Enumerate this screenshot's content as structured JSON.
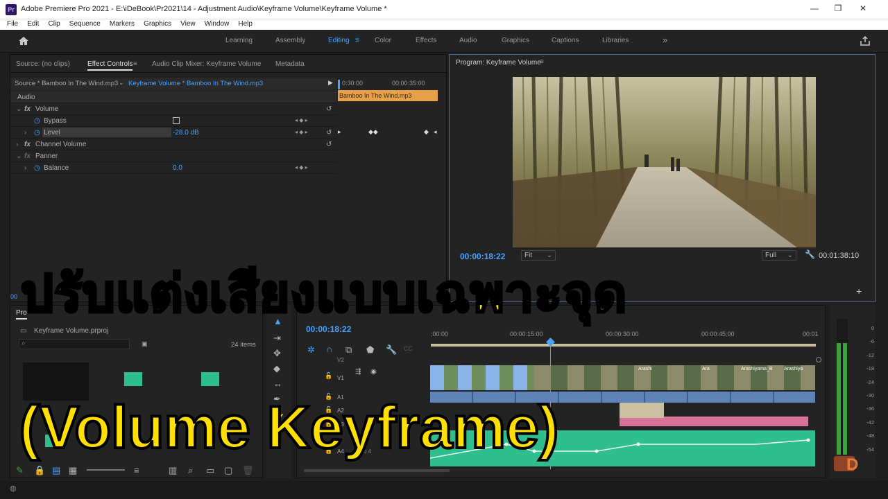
{
  "window": {
    "title": "Adobe Premiere Pro 2021 - E:\\iDeBook\\Pr2021\\14 - Adjustment Audio\\Keyframe Volume\\Keyframe Volume *",
    "app_icon": "Pr"
  },
  "menu": [
    "File",
    "Edit",
    "Clip",
    "Sequence",
    "Markers",
    "Graphics",
    "View",
    "Window",
    "Help"
  ],
  "workspaces": [
    "Learning",
    "Assembly",
    "Editing",
    "Color",
    "Effects",
    "Audio",
    "Graphics",
    "Captions",
    "Libraries"
  ],
  "active_workspace": "Editing",
  "source_panel": {
    "tabs": [
      "Source: (no clips)",
      "Effect Controls",
      "Audio Clip Mixer: Keyframe Volume",
      "Metadata"
    ],
    "active_tab": "Effect Controls",
    "master_clip": "Source * Bamboo In The Wind.mp3",
    "sequence_clip": "Keyframe Volume * Bamboo In The Wind.mp3",
    "ruler_start": "0:30:00",
    "ruler_end": "00:00:35:00",
    "clip_bar_label": "Bamboo In The Wind.mp3",
    "section": "Audio",
    "effects": {
      "volume": "Volume",
      "bypass": "Bypass",
      "level": "Level",
      "level_value": "-28.0 dB",
      "channel_volume": "Channel Volume",
      "panner": "Panner",
      "balance": "Balance",
      "balance_value": "0.0"
    },
    "fx_label": "fx"
  },
  "program_monitor": {
    "title": "Program: Keyframe Volume",
    "timecode": "00:00:18:22",
    "fit": "Fit",
    "quality": "Full",
    "duration": "00:01:38:10"
  },
  "project_panel": {
    "tab": "Pro",
    "project_file": "Keyframe Volume.prproj",
    "items_count": "24 items"
  },
  "timeline": {
    "timecode": "00:00:18:22",
    "ruler": [
      ":00:00",
      "00:00:15:00",
      "00:00:30:00",
      "00:00:45:00",
      "00:01"
    ],
    "tracks": [
      "V2",
      "V1",
      "A1",
      "A2",
      "A3",
      "A4"
    ],
    "v1_clip_labels": [
      "Arashi",
      "Ara",
      "Arashiyama_B",
      "Arashiya"
    ],
    "a4_label": "Audio 4"
  },
  "audio_meter": {
    "scale": [
      "0",
      "-6",
      "-12",
      "-18",
      "-24",
      "-30",
      "-36",
      "-42",
      "-48",
      "-54"
    ],
    "left_level": 0.82,
    "right_level": 0.82
  },
  "overlay": {
    "line1": "ปรับแต่งเสียงแบบเฉพาะจุด",
    "line2": "(Volume Keyframe)"
  },
  "colors": {
    "accent_blue": "#4aa3ff",
    "overlay_yellow": "#ffe000",
    "clip_video": "#8ab4e8",
    "clip_audio_green": "#2fbf8f",
    "clip_audio_pink": "#d9729a"
  }
}
